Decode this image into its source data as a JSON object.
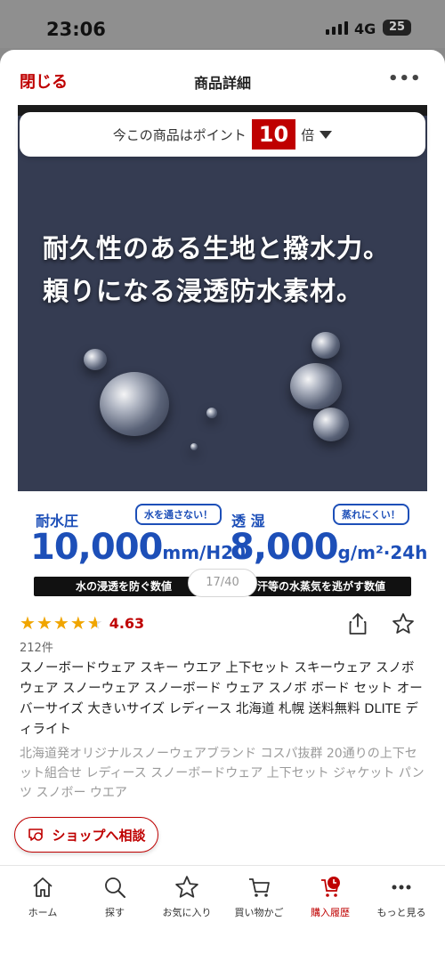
{
  "status_bar": {
    "time": "23:06",
    "network": "4G",
    "battery": "25"
  },
  "sheet": {
    "close_label": "閉じる",
    "title": "商品詳細",
    "more_label": "•••"
  },
  "point_banner": {
    "prefix": "今この商品はポイント",
    "multiplier": "10",
    "suffix": "倍"
  },
  "image": {
    "headline_1": "耐久性のある生地と撥水力。",
    "headline_2": "頼りになる浸透防水素材。",
    "waterproof": {
      "label": "耐水圧",
      "bubble": "水を通さない！",
      "value": "10,000",
      "unit": "mm/H20",
      "caption": "水の浸透を防ぐ数値"
    },
    "breathability": {
      "label": "透 湿",
      "bubble": "蒸れにくい！",
      "value": "8,000",
      "unit": "g/m²·24h",
      "caption": "汗等の水蒸気を逃がす数値"
    }
  },
  "pager": "17/40",
  "rating": {
    "value": "4.63",
    "reviews": "212件",
    "stars": 4.63
  },
  "product": {
    "title": "スノーボードウェア スキー ウエア 上下セット スキーウェア スノボウェア スノーウェア スノーボード ウェア スノボ ボード セット オーバーサイズ 大きいサイズ レディース 北海道 札幌 送料無料 DLITE ディライト",
    "description": "北海道発オリジナルスノーウェアブランド コスパ抜群 20通りの上下セット組合せ レディース スノーボードウェア 上下セット ジャケット パンツ スノボー ウエア"
  },
  "consult_label": "ショップへ相談",
  "nav": [
    {
      "label": "ホーム",
      "icon": "home-icon"
    },
    {
      "label": "探す",
      "icon": "search-icon"
    },
    {
      "label": "お気に入り",
      "icon": "star-icon"
    },
    {
      "label": "買い物かご",
      "icon": "cart-icon"
    },
    {
      "label": "購入履歴",
      "icon": "history-icon",
      "active": true
    },
    {
      "label": "もっと見る",
      "icon": "more-icon"
    }
  ],
  "colors": {
    "accent": "#bf0000",
    "spec_blue": "#1d4fb8",
    "star": "#f0a500"
  }
}
